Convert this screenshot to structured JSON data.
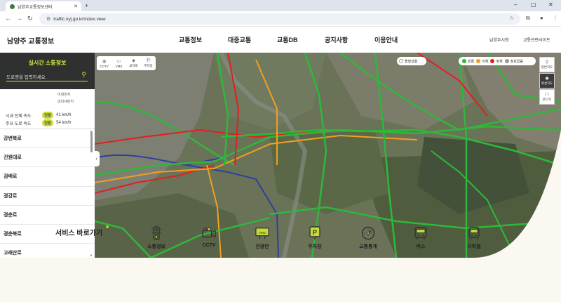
{
  "browser": {
    "tab_title": "남양주교통정보센터",
    "url": "traffic.nyj.go.kr/index.view"
  },
  "header": {
    "logo": "남양주 교통정보",
    "nav": [
      "교통정보",
      "대중교통",
      "교통DB",
      "공지사항",
      "이용안내"
    ],
    "util_links": [
      "남양주시청",
      "교통관련사이트"
    ]
  },
  "panel": {
    "title": "실시간 소통정보",
    "search_placeholder": "도로명을 입력하세요.",
    "legend": [
      "미세먼지",
      "초미세먼지"
    ],
    "speeds": [
      {
        "label": "시내 전체 속도",
        "status": "원활",
        "value": "41 km/h"
      },
      {
        "label": "주요 도로 속도",
        "status": "원활",
        "value": "54 km/h"
      }
    ],
    "roads": [
      "강변북로",
      "건원대로",
      "검배로",
      "경강로",
      "경춘로",
      "경춘북로",
      "고래산로"
    ]
  },
  "map": {
    "tools": [
      {
        "icon": "cctv-icon",
        "label": "CCTV"
      },
      {
        "icon": "vms-icon",
        "label": "VMS"
      },
      {
        "icon": "intersection-icon",
        "label": "교차로"
      },
      {
        "icon": "parking-icon",
        "label": "주차장"
      }
    ],
    "accident_label": "돌발상황",
    "legend": [
      {
        "label": "원활",
        "color": "#2eb83a"
      },
      {
        "label": "지체",
        "color": "#f0a020"
      },
      {
        "label": "정체",
        "color": "#e02020"
      },
      {
        "label": "정보없음",
        "color": "#9a9a9a"
      }
    ],
    "buttons": [
      {
        "icon": "map-pin-icon",
        "label": "일반지도"
      },
      {
        "icon": "satellite-icon",
        "label": "위성지도"
      },
      {
        "icon": "road-icon",
        "label": "로드뷰"
      }
    ]
  },
  "services": {
    "title": "서비스 바로가기",
    "items": [
      {
        "icon": "traffic-light-icon",
        "label": "소통정보"
      },
      {
        "icon": "cctv-camera-icon",
        "label": "CCTV"
      },
      {
        "icon": "vms-board-icon",
        "label": "전광판"
      },
      {
        "icon": "parking-icon",
        "label": "주차장"
      },
      {
        "icon": "gauge-icon",
        "label": "교통통계"
      },
      {
        "icon": "bus-icon",
        "label": "버스"
      },
      {
        "icon": "subway-icon",
        "label": "지하철"
      }
    ]
  },
  "colors": {
    "accent": "#d4e63b",
    "panel_bg": "#2f3030",
    "smooth": "#2eb83a",
    "delay": "#f0a020",
    "jam": "#e02020"
  }
}
